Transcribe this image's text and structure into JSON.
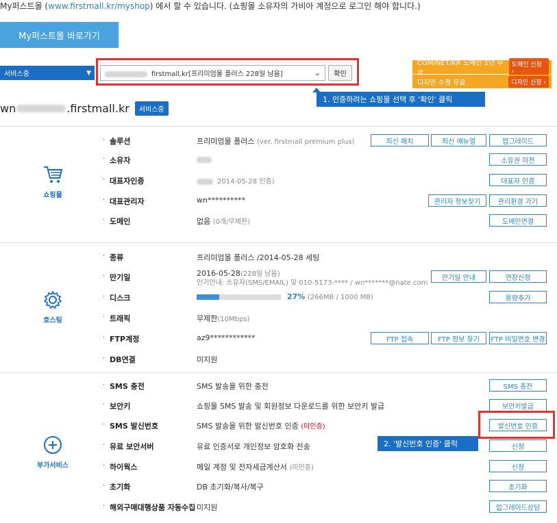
{
  "intro": {
    "prefix": "My퍼스트몰 (",
    "link": "www.firstmall.kr/myshop",
    "suffix": ") 에서 할 수 있습니다. (쇼핑몰 소유자의 가비아 계정으로 로그인 해야 합니다.)"
  },
  "my_button": "My퍼스트몰 바로가기",
  "status_select": "서비스중",
  "shop_select": "firstmall.kr[프리미엄몰 플러스 228일 남음]",
  "confirm_button": "확인",
  "promos": [
    {
      "text": "COM/NET/KR 도메인 1년 무료",
      "button": "도메인 신청 ›"
    },
    {
      "text": "디자인 수정 무료",
      "button": "디자인 신청 ›"
    }
  ],
  "callouts": {
    "one": "1. 인증하려는 쇼핑몰 선택 후 '확인' 클릭",
    "two": "2. '발신번호 인증' 클릭"
  },
  "domain": {
    "prefix": "wn",
    "suffix": ".firstmall.kr",
    "badge": "서비스중"
  },
  "sections": {
    "shop": {
      "title": "쇼핑몰",
      "rows": [
        {
          "label": "솔루션",
          "value": "프리미엄몰 플러스",
          "muted": "(ver. firstmall premium plus)",
          "buttons": [
            "최신 패치",
            "최신 매뉴얼",
            "업그레이드"
          ]
        },
        {
          "label": "소유자",
          "value": "",
          "muted": "",
          "buttons": [
            "소유권 이전"
          ]
        },
        {
          "label": "대표자인증",
          "value": "",
          "muted": "2014-05-28 인증)",
          "buttons": [
            "대표자 인증"
          ]
        },
        {
          "label": "대표관리자",
          "value": "wn**********",
          "muted": "",
          "buttons": [
            "관리자 정보찾기",
            "관리환경 가기"
          ]
        },
        {
          "label": "도메인",
          "value": "없음",
          "muted": "(0개/무제한)",
          "buttons": [
            "도메인연결"
          ]
        }
      ]
    },
    "hosting": {
      "title": "호스팅",
      "rows": [
        {
          "label": "종류",
          "value": "프리미엄몰 플러스 /2014-05-28 세팅",
          "muted": "",
          "buttons": []
        },
        {
          "label": "만기일",
          "value": "2016-05-28",
          "muted": "(228일 남음)",
          "sub": "만기안내: 소유자(SMS/EMAIL) 및 010-5173-**** / wn*******@nate.com",
          "buttons": [
            "만기일 안내",
            "연장신청"
          ]
        },
        {
          "label": "디스크",
          "value": "27%",
          "muted": "(266MB / 1000 MB)",
          "buttons": [
            "용량추가"
          ]
        },
        {
          "label": "트래픽",
          "value": "무제한",
          "muted": "(10Mbps)",
          "buttons": []
        },
        {
          "label": "FTP계정",
          "value": "az9************",
          "muted": "",
          "buttons": [
            "FTP 접속",
            "FTP 정보 찾기",
            "FTP 비밀번호 변경"
          ]
        },
        {
          "label": "DB연결",
          "value": "미지원",
          "muted": "",
          "buttons": []
        }
      ]
    },
    "addon": {
      "title": "부가서비스",
      "rows": [
        {
          "label": "SMS 충전",
          "value": "SMS 발송을 위한 충전",
          "muted": "",
          "red": "",
          "buttons": [
            "SMS 충전"
          ]
        },
        {
          "label": "보안키",
          "value": "쇼핑몰 SMS 발송 및 회원정보 다운로드를 위한 보안키 발급",
          "muted": "",
          "red": "",
          "buttons": [
            "보안키발급"
          ]
        },
        {
          "label": "SMS 발신번호",
          "value": "SMS 발송을 위한 발신번호 인증",
          "muted": "",
          "red": "(미인증)",
          "buttons": [
            "발신번호 인증"
          ]
        },
        {
          "label": "유료 보안서버",
          "value": "유료 인증서로 개인정보 암호화 전송",
          "muted": "",
          "red": "",
          "buttons": [
            "신청"
          ]
        },
        {
          "label": "하이웍스",
          "value": "메일 계정 및 전자세금계산서",
          "muted": "(미인증)",
          "red": "",
          "buttons": [
            "신청"
          ]
        },
        {
          "label": "초기화",
          "value": "DB 초기화/복사/복구",
          "muted": "",
          "red": "",
          "buttons": [
            "초기화"
          ]
        },
        {
          "label": "해외구매대행상품 자동수집",
          "value": "미지원",
          "muted": "",
          "red": "",
          "buttons": [
            "업그레이드상담"
          ]
        }
      ]
    }
  },
  "progress": {
    "disk_fraction": 0.27
  },
  "colors": {
    "primary": "#1a6fc4",
    "highlight": "#e03333",
    "promo": "#f5a623",
    "promo_button": "#e8550f"
  }
}
